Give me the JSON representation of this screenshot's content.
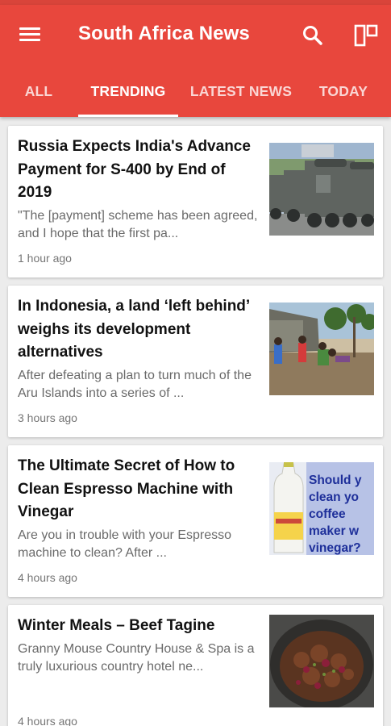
{
  "app": {
    "title": "South Africa News",
    "icons": {
      "menu": "hamburger-menu-icon",
      "search": "search-icon",
      "layout": "layout-toggle-icon"
    },
    "colors": {
      "appbar": "#e8473d",
      "status_bar": "#d9443a",
      "background": "#ececec"
    }
  },
  "tabs": [
    {
      "label": "ALL",
      "active": false
    },
    {
      "label": "TRENDING",
      "active": true
    },
    {
      "label": "LATEST NEWS",
      "active": false
    },
    {
      "label": "TODAY",
      "active": false
    }
  ],
  "articles": [
    {
      "title": "Russia Expects India's Advance Payment for S-400 by End of 2019",
      "snippet": "\"The [payment] scheme has been agreed, and I hope that the first pa...",
      "time": "1 hour ago",
      "image": "military-trucks-photo"
    },
    {
      "title": "In Indonesia, a land ‘left behind’ weighs its development alternatives",
      "snippet": "After defeating a plan to turn much of the Aru Islands into a series of ...",
      "time": "3 hours ago",
      "image": "village-children-photo"
    },
    {
      "title": "The Ultimate Secret of How to Clean Espresso Machine with Vinegar",
      "snippet": "Are you in trouble with your Espresso machine to clean? After ...",
      "time": "4 hours ago",
      "image": "vinegar-bottle-photo",
      "image_text": [
        "Should y",
        "clean yo",
        "coffee",
        "maker w",
        "vinegar?"
      ]
    },
    {
      "title": "Winter Meals – Beef Tagine",
      "snippet": "Granny Mouse Country House & Spa is a truly luxurious country hotel ne...",
      "time": "4 hours ago",
      "image": "beef-tagine-photo"
    }
  ]
}
